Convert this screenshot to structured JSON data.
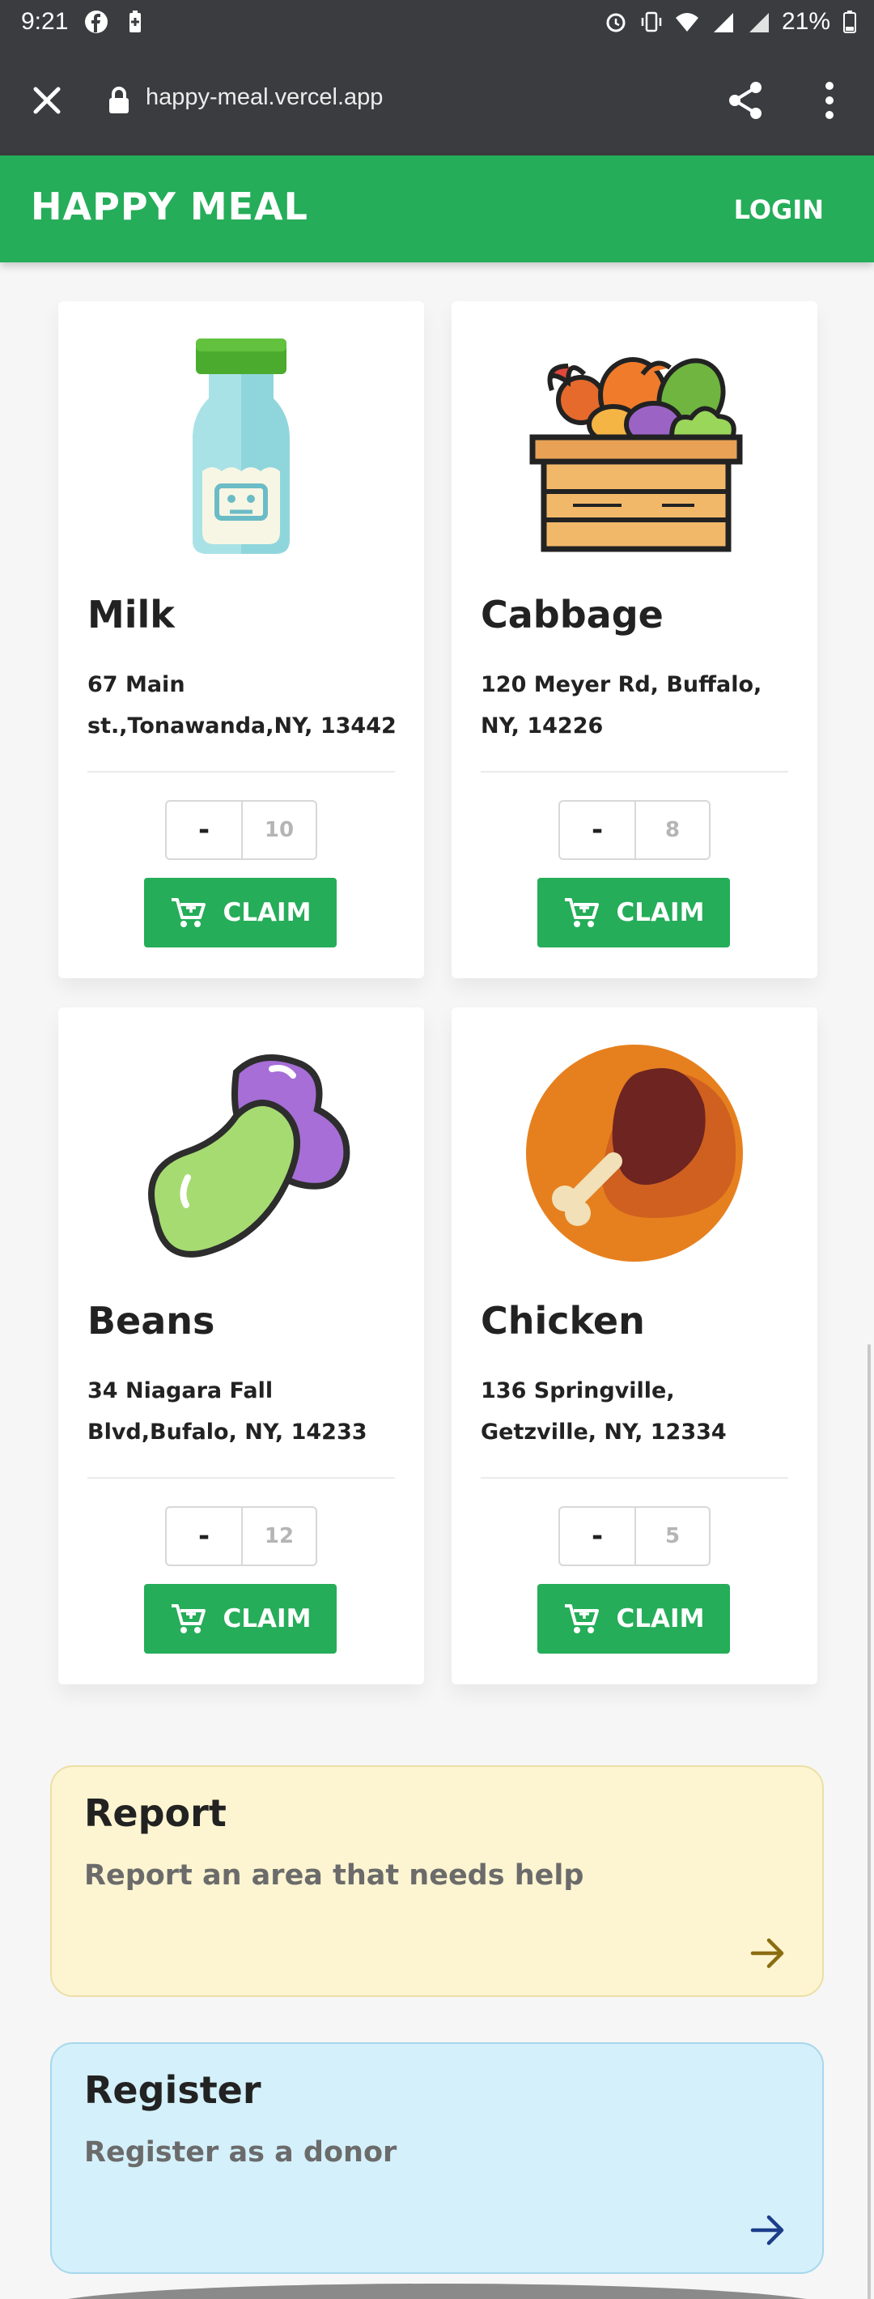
{
  "status_bar": {
    "time": "9:21",
    "battery": "21%"
  },
  "browser": {
    "url": "happy-meal.vercel.app"
  },
  "header": {
    "brand": "HAPPY MEAL",
    "login_label": "LOGIN"
  },
  "items": [
    {
      "name": "Milk",
      "address": "67 Main st.,Tonawanda,NY, 13442",
      "quantity": "10",
      "minus_label": "-",
      "claim_label": "CLAIM",
      "image_icon": "milk-bottle-icon"
    },
    {
      "name": "Cabbage",
      "address": "120 Meyer Rd, Buffalo, NY, 14226",
      "quantity": "8",
      "minus_label": "-",
      "claim_label": "CLAIM",
      "image_icon": "vegetable-crate-icon"
    },
    {
      "name": "Beans",
      "address": "34 Niagara Fall Blvd,Bufalo, NY, 14233",
      "quantity": "12",
      "minus_label": "-",
      "claim_label": "CLAIM",
      "image_icon": "beans-icon"
    },
    {
      "name": "Chicken",
      "address": "136 Springville, Getzville, NY, 12334",
      "quantity": "5",
      "minus_label": "-",
      "claim_label": "CLAIM",
      "image_icon": "chicken-leg-icon"
    }
  ],
  "report": {
    "title": "Report",
    "subtitle": "Report an area that needs help"
  },
  "register": {
    "title": "Register",
    "subtitle": "Register as a donor"
  },
  "colors": {
    "brand_green": "#25ad59",
    "report_bg": "#fdf5d1",
    "register_bg": "#d4f0fb",
    "report_arrow": "#8a6d10",
    "register_arrow": "#1c3d8a"
  }
}
